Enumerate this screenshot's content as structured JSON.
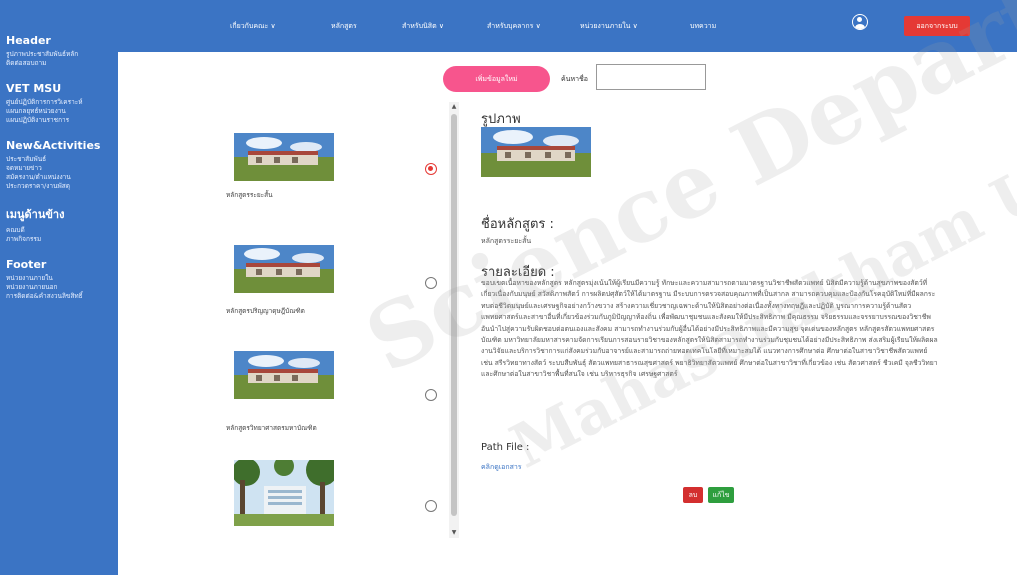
{
  "sidebar": {
    "sections": [
      {
        "title": "Header",
        "items": [
          "รูปภาพประชาสัมพันธ์หลัก",
          "ติดต่อสอบถาม"
        ]
      },
      {
        "title": "VET MSU",
        "items": [
          "ศูนย์ปฏิบัติการการวิเคราะห์",
          "แผนกลยุทธ์หน่วยงาน",
          "แผนปฏิบัติงานราชการ"
        ]
      },
      {
        "title": "New&Activities",
        "items": [
          "ประชาสัมพันธ์",
          "จดหมายข่าว",
          "สมัครงาน/ตำแหน่งงาน",
          "ประกวดราคา/งานพัสดุ"
        ]
      },
      {
        "title": "เมนูด้านข้าง",
        "items": [
          "คณบดี",
          "ภาพกิจกรรม"
        ]
      },
      {
        "title": "Footer",
        "items": [
          "หน่วยงานภายใน",
          "หน่วยงานภายนอก",
          "การติดต่อ&คำสงวนลิขสิทธิ์"
        ]
      }
    ]
  },
  "nav": {
    "items": [
      "เกี่ยวกับคณะ ∨",
      "หลักสูตร",
      "สำหรับนิสิต ∨",
      "สำหรับบุคลากร ∨",
      "หน่วยงานภายใน ∨",
      "บทความ"
    ],
    "logout_label": "ออกจากระบบ"
  },
  "toolbar": {
    "add_label": "เพิ่มข้อมูลใหม่",
    "search_label": "ค้นหาชื่อ",
    "search_value": ""
  },
  "list": {
    "items": [
      {
        "caption": "หลักสูตรระยะสั้น",
        "selected": true
      },
      {
        "caption": "หลักสูตรปริญญาดุษฎีบัณฑิต",
        "selected": false
      },
      {
        "caption": "หลักสูตรวิทยาศาสตรมหาบัณฑิต",
        "selected": false
      },
      {
        "caption": "",
        "selected": false
      }
    ]
  },
  "detail": {
    "image_heading": "รูปภาพ",
    "name_heading": "ชื่อหลักสูตร :",
    "name_value": "หลักสูตรระยะสั้น",
    "desc_heading": "รายละเอียด :",
    "description": "ขอบเขตเนื้อหาของหลักสูตร หลักสูตรมุ่งเน้นให้ผู้เรียนมีความรู้ ทักษะและความสามารถตามมาตรฐานวิชาชีพสัตวแพทย์ นิสิตมีความรู้ด้านสุขภาพของสัตว์ที่เกี่ยวเนื่องกับมนุษย์ สวัสดิภาพสัตว์ การผลิตปศุสัตว์ให้ได้มาตรฐาน มีระบบการตรวจสอบคุณภาพที่เป็นสากล สามารถควบคุมและป้องกันโรคอุบัติใหม่ที่มีผลกระทบต่อชีวิตมนุษย์และเศรษฐกิจอย่างกว้างขวาง สร้างความเชี่ยวชาญเฉพาะด้านให้นิสิตอย่างต่อเนื่องทั้งทางทฤษฎีและปฏิบัติ บูรณาการความรู้ด้านสัตวแพทยศาสตร์และสาขาอื่นที่เกี่ยวข้องร่วมกับภูมิปัญญาท้องถิ่น เพื่อพัฒนาชุมชนและสังคมให้มีประสิทธิภาพ มีคุณธรรม จริยธรรมและจรรยาบรรณของวิชาชีพ อันนำไปสู่ความรับผิดชอบต่อตนเองและสังคม สามารถทำงานร่วมกับผู้อื่นได้อย่างมีประสิทธิภาพและมีความสุข จุดเด่นของหลักสูตร หลักสูตรสัตวแพทยศาสตรบัณฑิต มหาวิทยาลัยมหาสารคามจัดการเรียนการสอนรายวิชาของหลักสูตรให้นิสิตสามารถทำงานร่วมกับชุมชนได้อย่างมีประสิทธิภาพ ส่งเสริมผู้เรียนให้ผลิตผลงานวิจัยและบริการวิชาการแก่สังคมร่วมกับอาจารย์และสามารถถ่ายทอดเทคโนโลยีที่เหมาะสมได้ แนวทางการศึกษาต่อ ศึกษาต่อในสาขาวิชาชีพสัตวแพทย์ เช่น สรีรวิทยาทางสัตว์ ระบบสืบพันธุ์ สัตวแพทยสาธารณสุขศาสตร์ พยาธิวิทยาสัตวแพทย์ ศึกษาต่อในสาขาวิชาที่เกี่ยวข้อง เช่น สัตวศาสตร์ ชีวเคมี จุลชีววิทยา และศึกษาต่อในสาขาวิชาพื้นที่สนใจ เช่น บริหารธุรกิจ เศรษฐศาสตร์",
    "path_heading": "Path File :",
    "path_link": "คลิกดูเอกสาร",
    "delete_label": "ลบ",
    "edit_label": "แก้ไข"
  },
  "watermark": {
    "line1": "Science Department",
    "line2": "Mahasarakham University"
  },
  "colors": {
    "sidebar": "#3b74c4",
    "add_button": "#f7558d",
    "logout_button": "#e53935",
    "delete_button": "#d32f2f",
    "edit_button": "#2e9e3e",
    "link": "#3b74c4"
  }
}
